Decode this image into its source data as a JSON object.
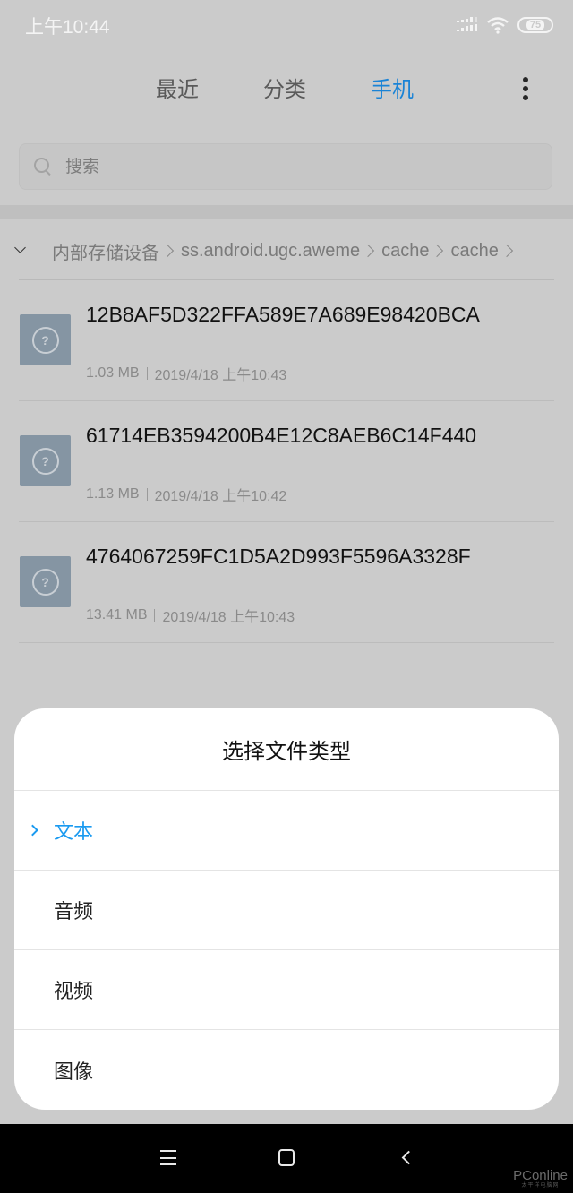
{
  "status_bar": {
    "time": "上午10:44",
    "battery": "75",
    "icons": [
      "signal-icon",
      "wifi-icon",
      "battery-icon"
    ]
  },
  "tabs": [
    {
      "label": "最近",
      "active": false
    },
    {
      "label": "分类",
      "active": false
    },
    {
      "label": "手机",
      "active": true
    }
  ],
  "more_icon": "more-vertical-icon",
  "search": {
    "placeholder": "搜索",
    "value": ""
  },
  "breadcrumb": {
    "toggle_icon": "chevron-down-icon",
    "items": [
      "内部存储设备",
      "ss.android.ugc.aweme",
      "cache",
      "cache"
    ]
  },
  "files": [
    {
      "name": "12B8AF5D322FFA589E7A689E98420BCA",
      "size": "1.03 MB",
      "date": "2019/4/18 上午10:43",
      "icon": "unknown-file-icon"
    },
    {
      "name": "61714EB3594200B4E12C8AEB6C14F440",
      "size": "1.13 MB",
      "date": "2019/4/18 上午10:42",
      "icon": "unknown-file-icon"
    },
    {
      "name": "4764067259FC1D5A2D993F5596A3328F",
      "size": "13.41 MB",
      "date": "2019/4/18 上午10:43",
      "icon": "unknown-file-icon"
    }
  ],
  "sheet": {
    "title": "选择文件类型",
    "options": [
      {
        "label": "文本",
        "selected": true
      },
      {
        "label": "音频",
        "selected": false
      },
      {
        "label": "视频",
        "selected": false
      },
      {
        "label": "图像",
        "selected": false
      }
    ]
  },
  "nav_bar": {
    "buttons": [
      "menu-icon",
      "home-icon",
      "back-icon"
    ]
  },
  "watermark": {
    "main": "PConline",
    "sub": "太平洋电脑网"
  },
  "colors": {
    "accent": "#1a83d6",
    "selected_option": "#1a9af0",
    "overlay_bg": "#cbcbcb",
    "file_icon_bg": "#8595a3"
  }
}
